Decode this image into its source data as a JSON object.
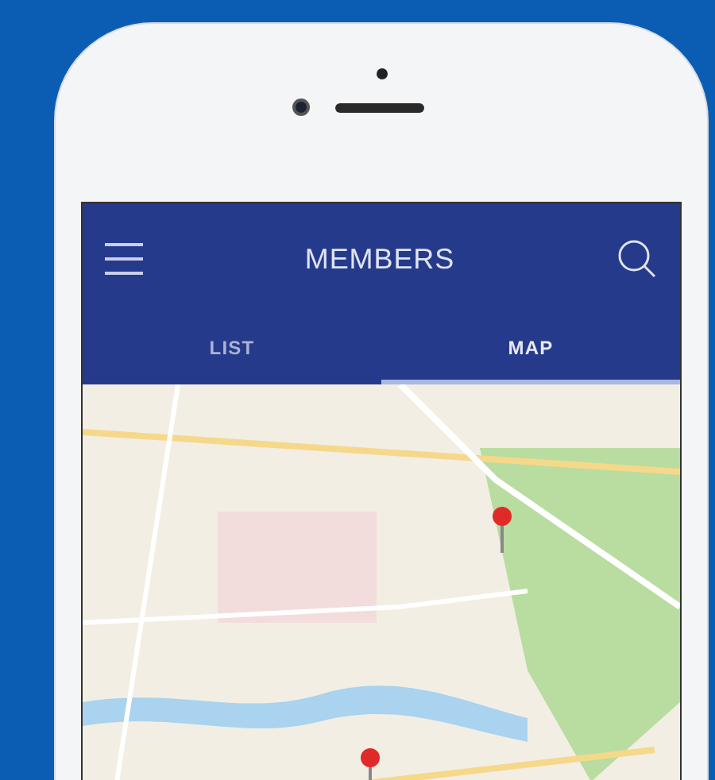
{
  "app_bar": {
    "title": "MEMBERS"
  },
  "tabs": [
    {
      "label": "LIST",
      "selected": false
    },
    {
      "label": "MAP",
      "selected": true
    }
  ]
}
